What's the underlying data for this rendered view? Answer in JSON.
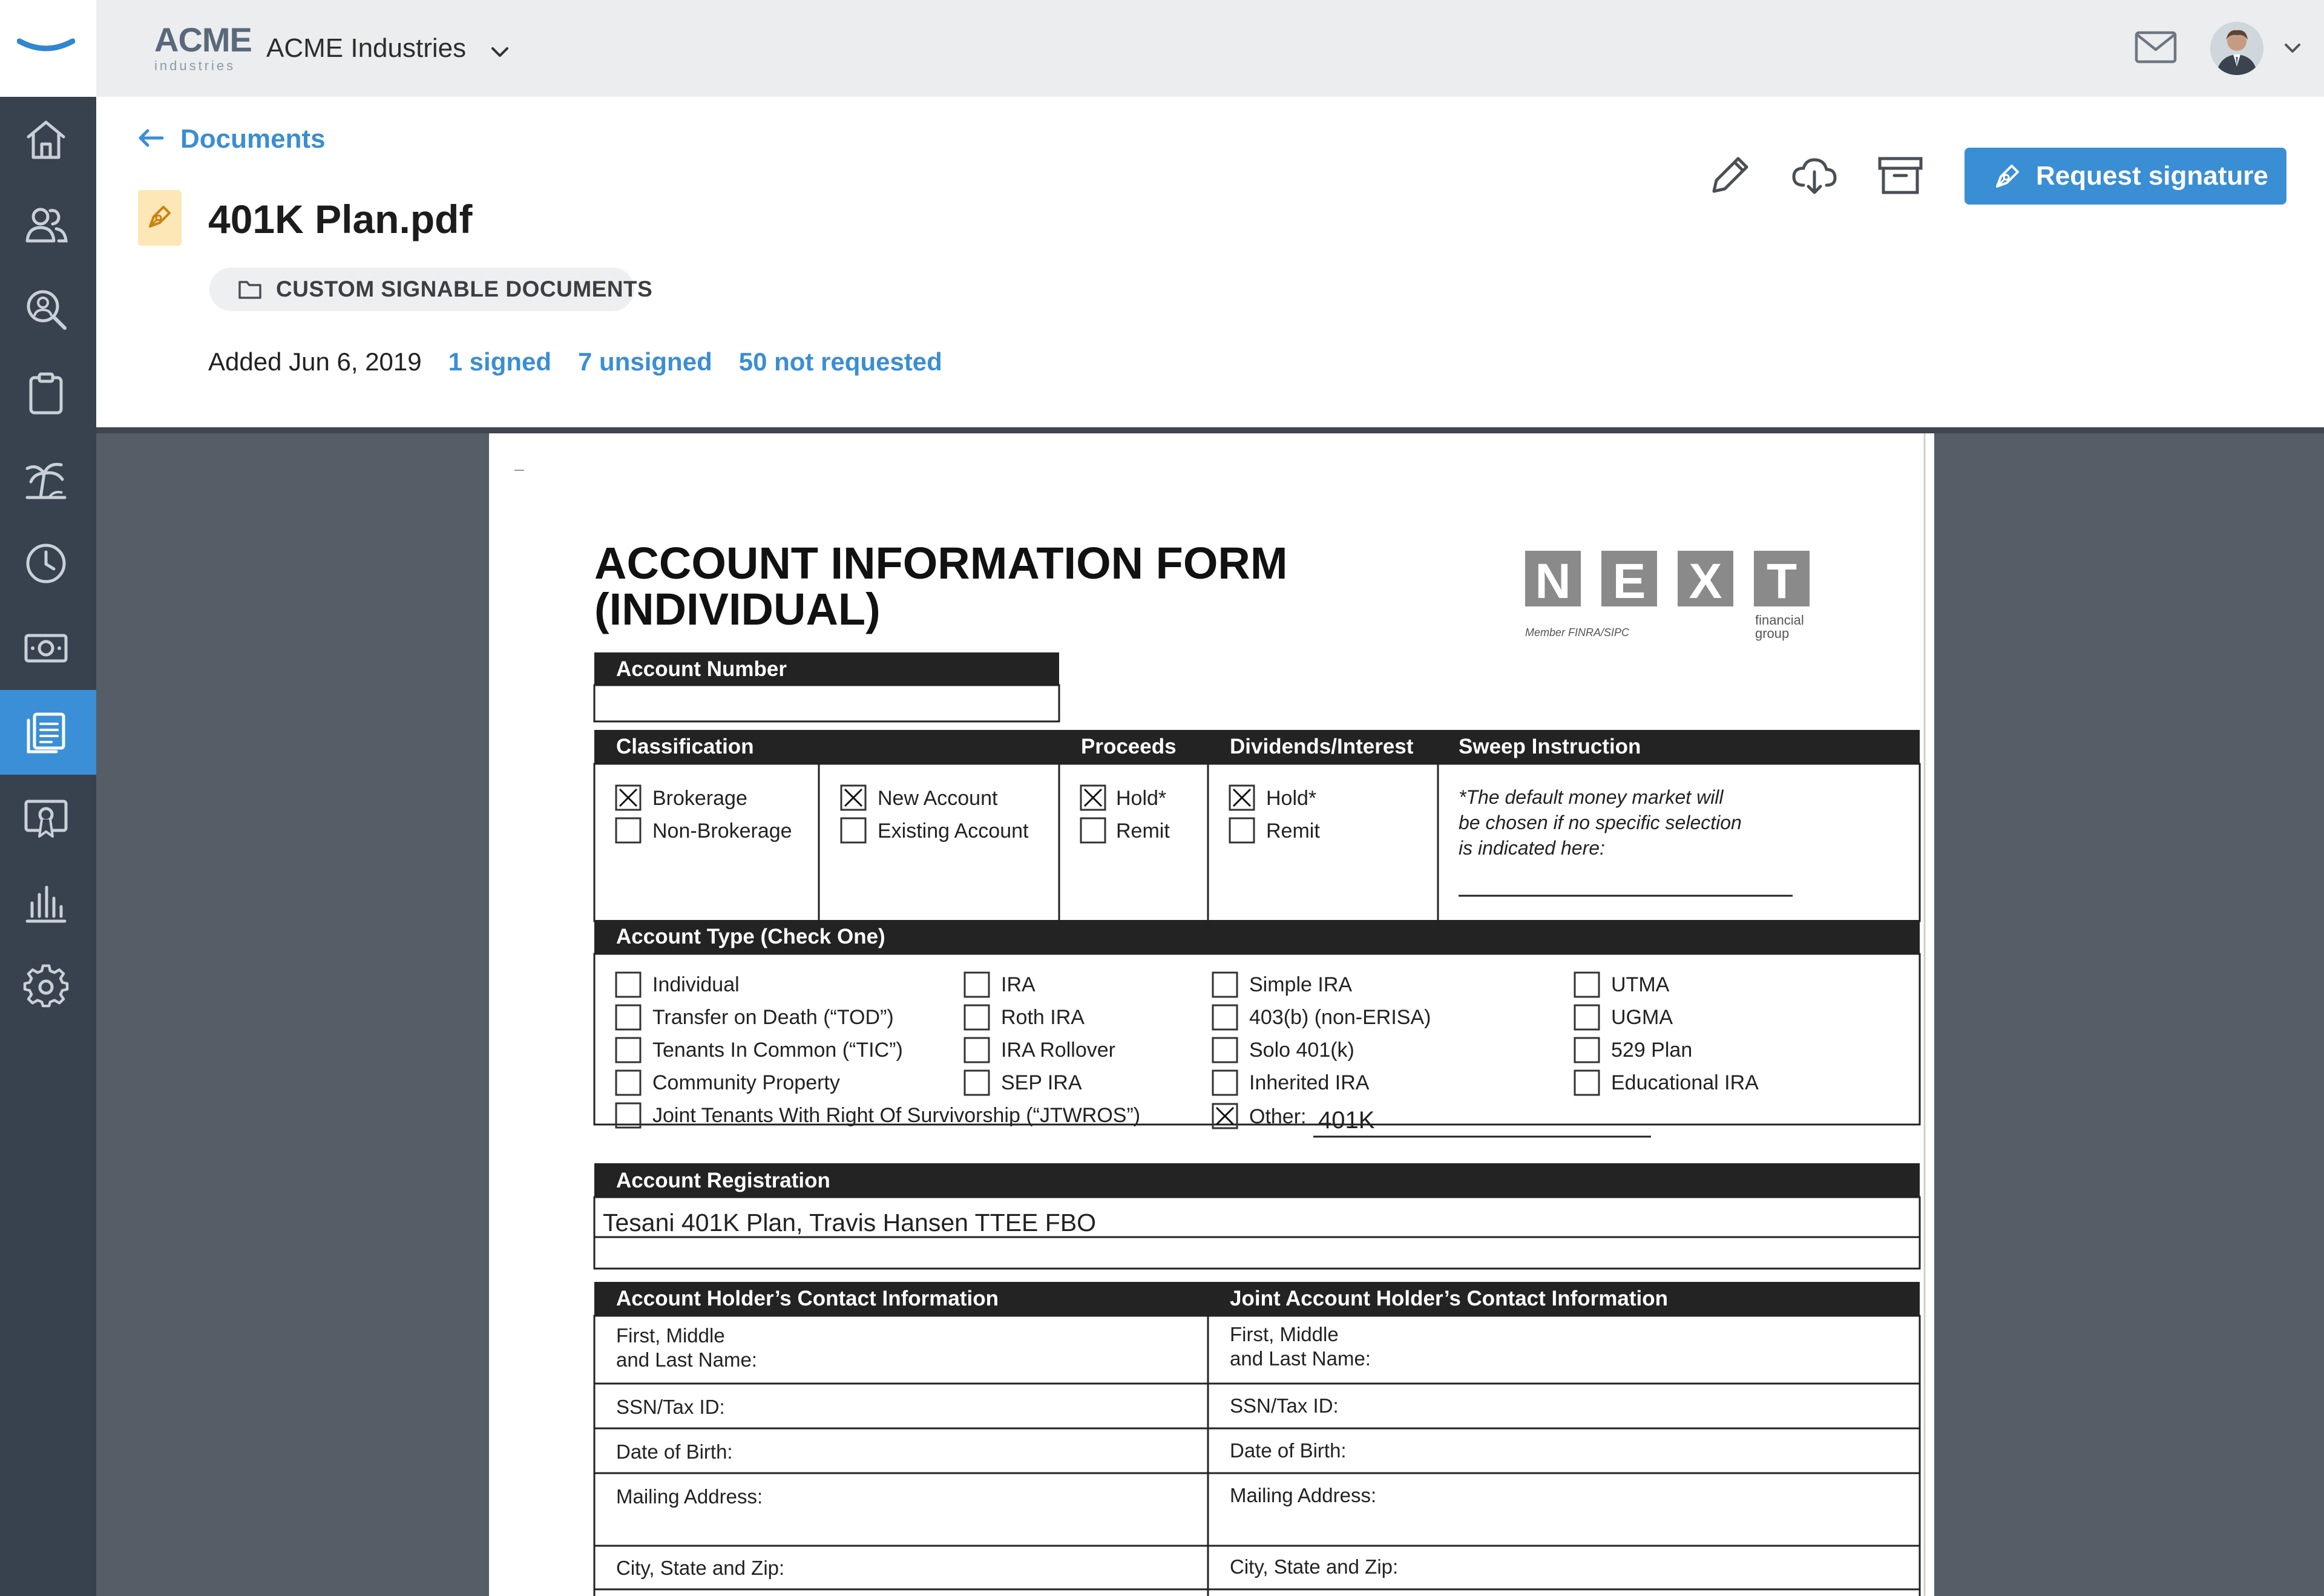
{
  "header": {
    "company_logo": {
      "word": "ACME",
      "sub": "industries"
    },
    "company_name": "ACME Industries"
  },
  "sidebar": {
    "items": [
      {
        "icon": "home-icon",
        "active": false
      },
      {
        "icon": "users-icon",
        "active": false
      },
      {
        "icon": "person-search-icon",
        "active": false
      },
      {
        "icon": "clipboard-icon",
        "active": false
      },
      {
        "icon": "palm-tree-icon",
        "active": false
      },
      {
        "icon": "clock-icon",
        "active": false
      },
      {
        "icon": "money-icon",
        "active": false
      },
      {
        "icon": "documents-icon",
        "active": true
      },
      {
        "icon": "certificate-icon",
        "active": false
      },
      {
        "icon": "bar-chart-icon",
        "active": false
      },
      {
        "icon": "gear-icon",
        "active": false
      }
    ]
  },
  "page": {
    "back_label": "Documents",
    "title": "401K Plan.pdf",
    "folder": "CUSTOM SIGNABLE DOCUMENTS",
    "added": "Added Jun 6, 2019",
    "signed": "1 signed",
    "unsigned": "7 unsigned",
    "not_requested": "50 not requested",
    "request_button": "Request signature"
  },
  "colors": {
    "accent": "#3a8ed3",
    "sidebar": "#37424e",
    "viewer_bg": "#555d66"
  },
  "form": {
    "title_line1": "ACCOUNT INFORMATION FORM",
    "title_line2": "(INDIVIDUAL)",
    "logo_letters": [
      "N",
      "E",
      "X",
      "T"
    ],
    "logo_member": "Member FINRA/SIPC",
    "logo_financial": "financial",
    "logo_group": "group",
    "account_number_label": "Account Number",
    "classification_label": "Classification",
    "proceeds_label": "Proceeds",
    "dividends_label": "Dividends/Interest",
    "sweep_label": "Sweep Instruction",
    "classification_options": [
      {
        "label": "Brokerage",
        "checked": true
      },
      {
        "label": "Non-Brokerage",
        "checked": false
      }
    ],
    "new_account_options": [
      {
        "label": "New Account",
        "checked": true
      },
      {
        "label": "Existing Account",
        "checked": false
      }
    ],
    "proceeds_options": [
      {
        "label": "Hold*",
        "checked": true
      },
      {
        "label": "Remit",
        "checked": false
      }
    ],
    "dividends_options": [
      {
        "label": "Hold*",
        "checked": true
      },
      {
        "label": "Remit",
        "checked": false
      }
    ],
    "sweep_note_lines": [
      "*The default money market will",
      "be chosen if no specific selection",
      "is indicated here:"
    ],
    "account_type_label": "Account Type (Check One)",
    "account_type_col1": [
      {
        "label": "Individual",
        "checked": false
      },
      {
        "label": "Transfer on Death (“TOD”)",
        "checked": false
      },
      {
        "label": "Tenants In Common (“TIC”)",
        "checked": false
      },
      {
        "label": "Community Property",
        "checked": false
      },
      {
        "label": "Joint Tenants With Right Of Survivorship (“JTWROS”)",
        "checked": false
      }
    ],
    "account_type_col2": [
      {
        "label": "IRA",
        "checked": false
      },
      {
        "label": "Roth IRA",
        "checked": false
      },
      {
        "label": "IRA Rollover",
        "checked": false
      },
      {
        "label": "SEP IRA",
        "checked": false
      }
    ],
    "account_type_col3": [
      {
        "label": "Simple IRA",
        "checked": false
      },
      {
        "label": "403(b) (non-ERISA)",
        "checked": false
      },
      {
        "label": "Solo 401(k)",
        "checked": false
      },
      {
        "label": "Inherited IRA",
        "checked": false
      },
      {
        "label": "Other:",
        "checked": true
      }
    ],
    "account_type_col4": [
      {
        "label": "UTMA",
        "checked": false
      },
      {
        "label": "UGMA",
        "checked": false
      },
      {
        "label": "529 Plan",
        "checked": false
      },
      {
        "label": "Educational IRA",
        "checked": false
      }
    ],
    "other_value": "401K",
    "registration_label": "Account Registration",
    "registration_value": "Tesani 401K Plan, Travis Hansen TTEE FBO",
    "holder_label": "Account Holder’s Contact Information",
    "joint_label": "Joint Account Holder’s Contact Information",
    "contact_fields": [
      "First, Middle",
      "and Last Name:",
      "SSN/Tax ID:",
      "Date of Birth:",
      "Mailing Address:",
      "City, State and Zip:"
    ]
  }
}
